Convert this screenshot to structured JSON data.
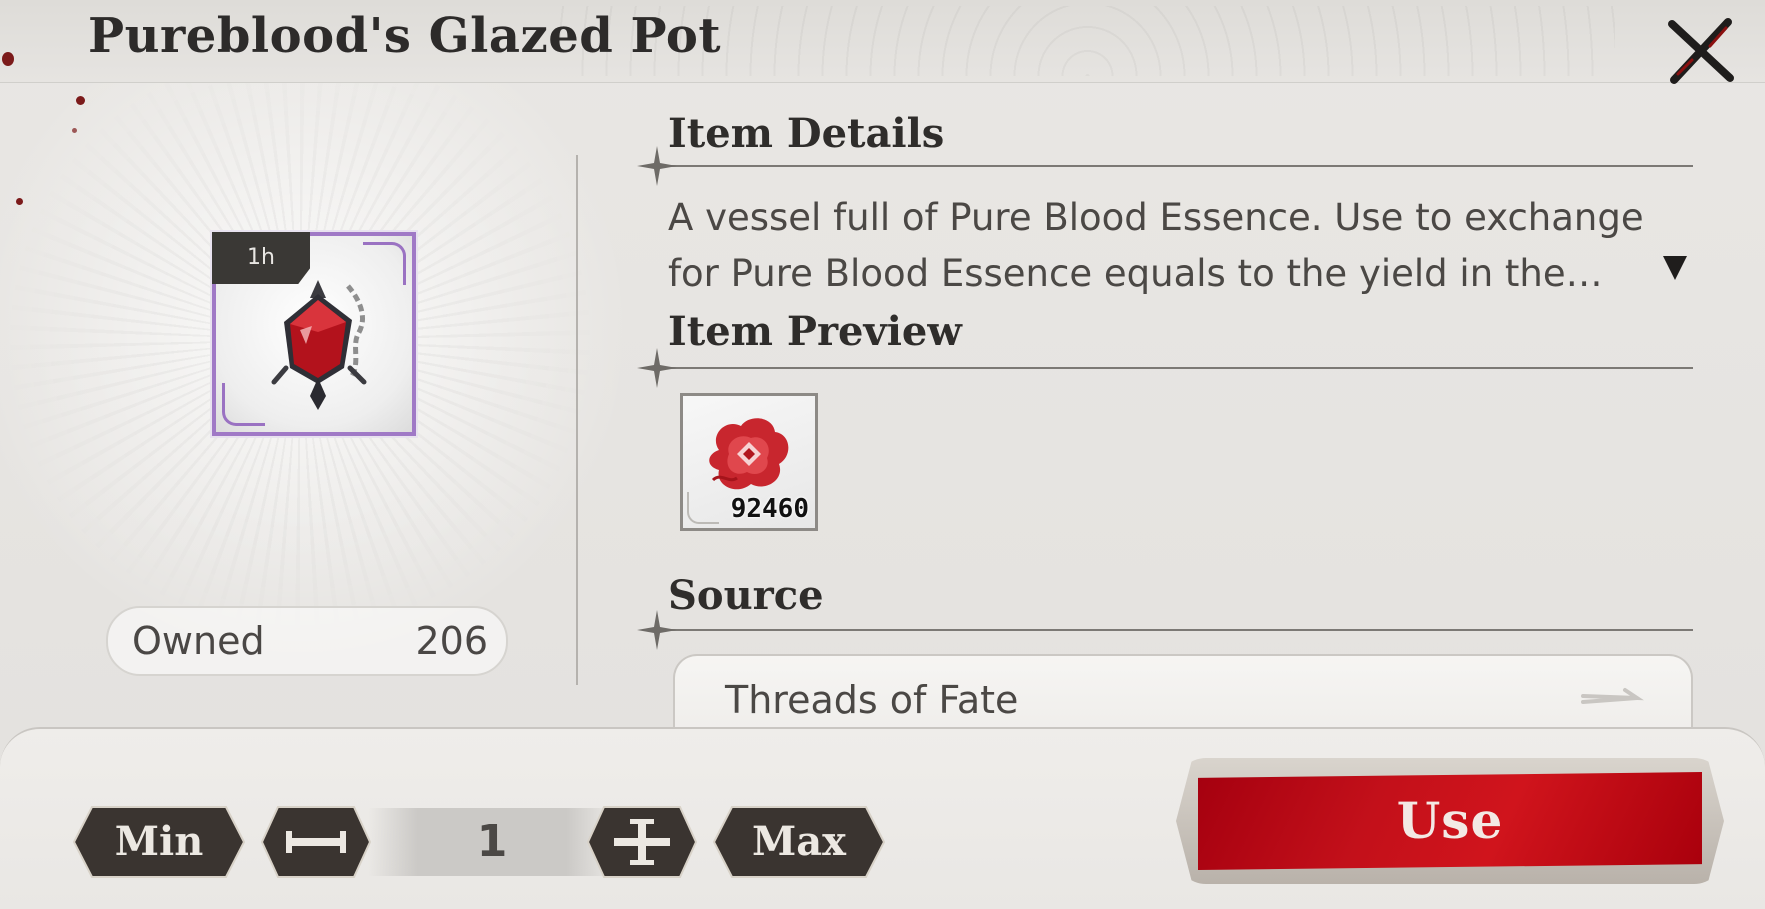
{
  "dialog": {
    "title": "Pureblood's Glazed Pot"
  },
  "item": {
    "duration_badge": "1h",
    "frame_color": "#a079c6",
    "owned_label": "Owned",
    "owned_count": "206"
  },
  "details": {
    "heading": "Item Details",
    "description": "A vessel full of Pure Blood Essence. Use to exchange for Pure Blood Essence equals to the yield in the specified time."
  },
  "preview": {
    "heading": "Item Preview",
    "items": [
      {
        "icon": "blood-essence-icon",
        "quantity": "92460"
      }
    ]
  },
  "source": {
    "heading": "Source",
    "entries": [
      {
        "label": "Threads of Fate"
      }
    ]
  },
  "quantity": {
    "min_label": "Min",
    "max_label": "Max",
    "value": "1"
  },
  "actions": {
    "use_label": "Use",
    "use_color": "#c3101a"
  }
}
